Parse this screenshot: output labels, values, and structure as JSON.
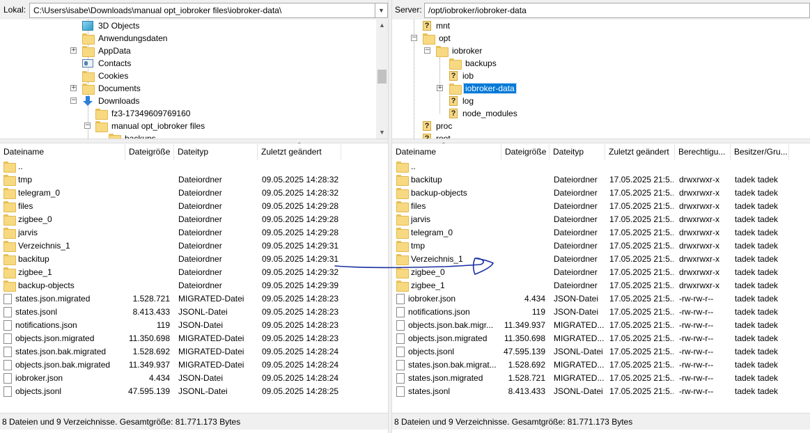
{
  "local": {
    "label": "Lokal:",
    "path": "C:\\Users\\isabe\\Downloads\\manual opt_iobroker files\\iobroker-data\\",
    "tree": [
      {
        "label": "3D Objects",
        "icon": "cube-icon"
      },
      {
        "label": "Anwendungsdaten",
        "icon": "folder-icon"
      },
      {
        "label": "AppData",
        "icon": "folder-icon"
      },
      {
        "label": "Contacts",
        "icon": "contacts-icon"
      },
      {
        "label": "Cookies",
        "icon": "folder-icon"
      },
      {
        "label": "Documents",
        "icon": "folder-icon"
      },
      {
        "label": "Downloads",
        "icon": "download-icon"
      },
      {
        "label": "fz3-17349609769160",
        "icon": "folder-icon"
      },
      {
        "label": "manual opt_iobroker files",
        "icon": "folder-icon"
      },
      {
        "label": "backups",
        "icon": "folder-icon"
      }
    ],
    "columns": [
      "Dateiname",
      "Dateigröße",
      "Dateityp",
      "Zuletzt geändert"
    ],
    "files": [
      {
        "name": "..",
        "size": "",
        "type": "",
        "modified": "",
        "kind": "folder"
      },
      {
        "name": "tmp",
        "size": "",
        "type": "Dateiordner",
        "modified": "09.05.2025 14:28:32",
        "kind": "folder"
      },
      {
        "name": "telegram_0",
        "size": "",
        "type": "Dateiordner",
        "modified": "09.05.2025 14:28:32",
        "kind": "folder"
      },
      {
        "name": "files",
        "size": "",
        "type": "Dateiordner",
        "modified": "09.05.2025 14:29:28",
        "kind": "folder"
      },
      {
        "name": "zigbee_0",
        "size": "",
        "type": "Dateiordner",
        "modified": "09.05.2025 14:29:28",
        "kind": "folder"
      },
      {
        "name": "jarvis",
        "size": "",
        "type": "Dateiordner",
        "modified": "09.05.2025 14:29:28",
        "kind": "folder"
      },
      {
        "name": "Verzeichnis_1",
        "size": "",
        "type": "Dateiordner",
        "modified": "09.05.2025 14:29:31",
        "kind": "folder"
      },
      {
        "name": "backitup",
        "size": "",
        "type": "Dateiordner",
        "modified": "09.05.2025 14:29:31",
        "kind": "folder"
      },
      {
        "name": "zigbee_1",
        "size": "",
        "type": "Dateiordner",
        "modified": "09.05.2025 14:29:32",
        "kind": "folder"
      },
      {
        "name": "backup-objects",
        "size": "",
        "type": "Dateiordner",
        "modified": "09.05.2025 14:29:39",
        "kind": "folder"
      },
      {
        "name": "states.json.migrated",
        "size": "1.528.721",
        "type": "MIGRATED-Datei",
        "modified": "09.05.2025 14:28:23",
        "kind": "file"
      },
      {
        "name": "states.jsonl",
        "size": "8.413.433",
        "type": "JSONL-Datei",
        "modified": "09.05.2025 14:28:23",
        "kind": "file"
      },
      {
        "name": "notifications.json",
        "size": "119",
        "type": "JSON-Datei",
        "modified": "09.05.2025 14:28:23",
        "kind": "file"
      },
      {
        "name": "objects.json.migrated",
        "size": "11.350.698",
        "type": "MIGRATED-Datei",
        "modified": "09.05.2025 14:28:23",
        "kind": "file"
      },
      {
        "name": "states.json.bak.migrated",
        "size": "1.528.692",
        "type": "MIGRATED-Datei",
        "modified": "09.05.2025 14:28:24",
        "kind": "file"
      },
      {
        "name": "objects.json.bak.migrated",
        "size": "11.349.937",
        "type": "MIGRATED-Datei",
        "modified": "09.05.2025 14:28:24",
        "kind": "file"
      },
      {
        "name": "iobroker.json",
        "size": "4.434",
        "type": "JSON-Datei",
        "modified": "09.05.2025 14:28:24",
        "kind": "file"
      },
      {
        "name": "objects.jsonl",
        "size": "47.595.139",
        "type": "JSONL-Datei",
        "modified": "09.05.2025 14:28:25",
        "kind": "file"
      }
    ],
    "status": "8 Dateien und 9 Verzeichnisse. Gesamtgröße: 81.771.173 Bytes"
  },
  "remote": {
    "label": "Server:",
    "path": "/opt/iobroker/iobroker-data",
    "tree": [
      {
        "label": "mnt",
        "icon": "unknown-folder-icon"
      },
      {
        "label": "opt",
        "icon": "folder-icon"
      },
      {
        "label": "iobroker",
        "icon": "folder-icon"
      },
      {
        "label": "backups",
        "icon": "folder-icon"
      },
      {
        "label": "iob",
        "icon": "unknown-folder-icon"
      },
      {
        "label": "iobroker-data",
        "icon": "folder-icon"
      },
      {
        "label": "log",
        "icon": "unknown-folder-icon"
      },
      {
        "label": "node_modules",
        "icon": "unknown-folder-icon"
      },
      {
        "label": "proc",
        "icon": "unknown-folder-icon"
      },
      {
        "label": "root",
        "icon": "unknown-folder-icon"
      }
    ],
    "columns": [
      "Dateiname",
      "Dateigröße",
      "Dateityp",
      "Zuletzt geändert",
      "Berechtigu...",
      "Besitzer/Gru..."
    ],
    "files": [
      {
        "name": "..",
        "size": "",
        "type": "",
        "modified": "",
        "perm": "",
        "owner": "",
        "kind": "folder"
      },
      {
        "name": "backitup",
        "size": "",
        "type": "Dateiordner",
        "modified": "17.05.2025 21:5...",
        "perm": "drwxrwxr-x",
        "owner": "tadek tadek",
        "kind": "folder"
      },
      {
        "name": "backup-objects",
        "size": "",
        "type": "Dateiordner",
        "modified": "17.05.2025 21:5...",
        "perm": "drwxrwxr-x",
        "owner": "tadek tadek",
        "kind": "folder"
      },
      {
        "name": "files",
        "size": "",
        "type": "Dateiordner",
        "modified": "17.05.2025 21:5...",
        "perm": "drwxrwxr-x",
        "owner": "tadek tadek",
        "kind": "folder"
      },
      {
        "name": "jarvis",
        "size": "",
        "type": "Dateiordner",
        "modified": "17.05.2025 21:5...",
        "perm": "drwxrwxr-x",
        "owner": "tadek tadek",
        "kind": "folder"
      },
      {
        "name": "telegram_0",
        "size": "",
        "type": "Dateiordner",
        "modified": "17.05.2025 21:5...",
        "perm": "drwxrwxr-x",
        "owner": "tadek tadek",
        "kind": "folder"
      },
      {
        "name": "tmp",
        "size": "",
        "type": "Dateiordner",
        "modified": "17.05.2025 21:5...",
        "perm": "drwxrwxr-x",
        "owner": "tadek tadek",
        "kind": "folder"
      },
      {
        "name": "Verzeichnis_1",
        "size": "",
        "type": "Dateiordner",
        "modified": "17.05.2025 21:5...",
        "perm": "drwxrwxr-x",
        "owner": "tadek tadek",
        "kind": "folder"
      },
      {
        "name": "zigbee_0",
        "size": "",
        "type": "Dateiordner",
        "modified": "17.05.2025 21:5...",
        "perm": "drwxrwxr-x",
        "owner": "tadek tadek",
        "kind": "folder"
      },
      {
        "name": "zigbee_1",
        "size": "",
        "type": "Dateiordner",
        "modified": "17.05.2025 21:5...",
        "perm": "drwxrwxr-x",
        "owner": "tadek tadek",
        "kind": "folder"
      },
      {
        "name": "iobroker.json",
        "size": "4.434",
        "type": "JSON-Datei",
        "modified": "17.05.2025 21:5...",
        "perm": "-rw-rw-r--",
        "owner": "tadek tadek",
        "kind": "file"
      },
      {
        "name": "notifications.json",
        "size": "119",
        "type": "JSON-Datei",
        "modified": "17.05.2025 21:5...",
        "perm": "-rw-rw-r--",
        "owner": "tadek tadek",
        "kind": "file"
      },
      {
        "name": "objects.json.bak.migr...",
        "size": "11.349.937",
        "type": "MIGRATED...",
        "modified": "17.05.2025 21:5...",
        "perm": "-rw-rw-r--",
        "owner": "tadek tadek",
        "kind": "file"
      },
      {
        "name": "objects.json.migrated",
        "size": "11.350.698",
        "type": "MIGRATED...",
        "modified": "17.05.2025 21:5...",
        "perm": "-rw-rw-r--",
        "owner": "tadek tadek",
        "kind": "file"
      },
      {
        "name": "objects.jsonl",
        "size": "47.595.139",
        "type": "JSONL-Datei",
        "modified": "17.05.2025 21:5...",
        "perm": "-rw-rw-r--",
        "owner": "tadek tadek",
        "kind": "file"
      },
      {
        "name": "states.json.bak.migrat...",
        "size": "1.528.692",
        "type": "MIGRATED...",
        "modified": "17.05.2025 21:5...",
        "perm": "-rw-rw-r--",
        "owner": "tadek tadek",
        "kind": "file"
      },
      {
        "name": "states.json.migrated",
        "size": "1.528.721",
        "type": "MIGRATED...",
        "modified": "17.05.2025 21:5...",
        "perm": "-rw-rw-r--",
        "owner": "tadek tadek",
        "kind": "file"
      },
      {
        "name": "states.jsonl",
        "size": "8.413.433",
        "type": "JSONL-Datei",
        "modified": "17.05.2025 21:5...",
        "perm": "-rw-rw-r--",
        "owner": "tadek tadek",
        "kind": "file"
      }
    ],
    "status": "8 Dateien und 9 Verzeichnisse. Gesamtgröße: 81.771.173 Bytes"
  },
  "colors": {
    "selection": "#0078d7",
    "folder": "#f7d981",
    "annotation": "#1a2fa0"
  }
}
